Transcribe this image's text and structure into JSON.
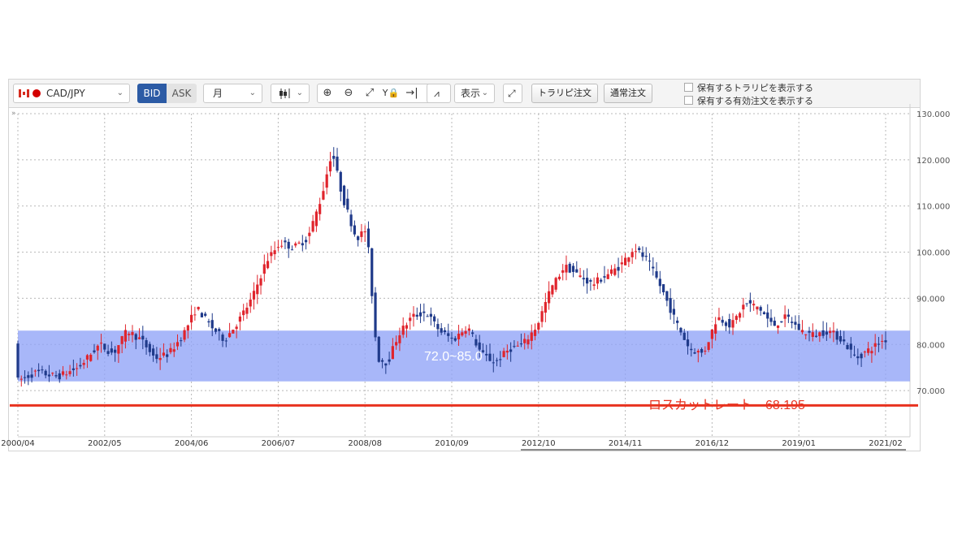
{
  "toolbar": {
    "pair": "CAD/JPY",
    "bid_label": "BID",
    "ask_label": "ASK",
    "timeframe": "月",
    "display_label": "表示",
    "trap_button": "トラリピ注文",
    "normal_button": "通常注文",
    "checkbox_positions": "保有するトラリピを表示する",
    "checkbox_orders": "保有する有効注文を表示する",
    "expand_mark": "»",
    "icons": [
      "candlestick-icon",
      "zoom-in-icon",
      "zoom-out-icon",
      "fit-icon",
      "y-lock-icon",
      "scroll-end-icon",
      "indicator-icon",
      "fullscreen-icon"
    ]
  },
  "annotations": {
    "band_label": "72.0~85.0",
    "losscut_label": "ロスカットレート　68.195"
  },
  "colors": {
    "up": "#e0242c",
    "down": "#1f3a8a",
    "band": "#8fa3f7",
    "losscut": "#e8321f",
    "accent": "#2c5ba5"
  },
  "chart_data": {
    "type": "candlestick",
    "title": "",
    "xlabel": "",
    "ylabel": "",
    "ylim": [
      60,
      130
    ],
    "y_ticks": [
      "130.000",
      "120.000",
      "110.000",
      "100.000",
      "90.000",
      "80.000",
      "70.000"
    ],
    "x_ticks": [
      "2000/04",
      "2002/05",
      "2004/06",
      "2006/07",
      "2008/08",
      "2010/09",
      "2012/10",
      "2014/11",
      "2016/12",
      "2019/01",
      "2021/02"
    ],
    "x_range": [
      "2000/04",
      "2021/02"
    ],
    "grid": true,
    "band": {
      "from": 72.0,
      "to": 83.0,
      "label": "72.0~85.0"
    },
    "losscut": {
      "value": 68.195,
      "label": "ロスカットレート　68.195"
    },
    "series": [
      {
        "t": "2000/04",
        "v": 72
      },
      {
        "t": "2000/10",
        "v": 74
      },
      {
        "t": "2001/04",
        "v": 73
      },
      {
        "t": "2001/10",
        "v": 75
      },
      {
        "t": "2002/04",
        "v": 80
      },
      {
        "t": "2002/08",
        "v": 78
      },
      {
        "t": "2002/12",
        "v": 83
      },
      {
        "t": "2003/04",
        "v": 81
      },
      {
        "t": "2003/08",
        "v": 77
      },
      {
        "t": "2003/12",
        "v": 78
      },
      {
        "t": "2004/04",
        "v": 82
      },
      {
        "t": "2004/08",
        "v": 88
      },
      {
        "t": "2004/12",
        "v": 84
      },
      {
        "t": "2005/04",
        "v": 81
      },
      {
        "t": "2005/08",
        "v": 85
      },
      {
        "t": "2005/12",
        "v": 90
      },
      {
        "t": "2006/04",
        "v": 98
      },
      {
        "t": "2006/08",
        "v": 102
      },
      {
        "t": "2006/12",
        "v": 101
      },
      {
        "t": "2007/04",
        "v": 103
      },
      {
        "t": "2007/08",
        "v": 112
      },
      {
        "t": "2007/11",
        "v": 122
      },
      {
        "t": "2008/02",
        "v": 112
      },
      {
        "t": "2008/06",
        "v": 103
      },
      {
        "t": "2008/09",
        "v": 105
      },
      {
        "t": "2008/12",
        "v": 77
      },
      {
        "t": "2009/03",
        "v": 76
      },
      {
        "t": "2009/06",
        "v": 82
      },
      {
        "t": "2009/10",
        "v": 86
      },
      {
        "t": "2010/02",
        "v": 87
      },
      {
        "t": "2010/06",
        "v": 83
      },
      {
        "t": "2010/10",
        "v": 81
      },
      {
        "t": "2011/02",
        "v": 84
      },
      {
        "t": "2011/06",
        "v": 78
      },
      {
        "t": "2011/10",
        "v": 76
      },
      {
        "t": "2012/02",
        "v": 79
      },
      {
        "t": "2012/06",
        "v": 80
      },
      {
        "t": "2012/10",
        "v": 84
      },
      {
        "t": "2013/02",
        "v": 92
      },
      {
        "t": "2013/06",
        "v": 97
      },
      {
        "t": "2013/10",
        "v": 95
      },
      {
        "t": "2014/02",
        "v": 93
      },
      {
        "t": "2014/06",
        "v": 95
      },
      {
        "t": "2014/10",
        "v": 97
      },
      {
        "t": "2015/02",
        "v": 101
      },
      {
        "t": "2015/06",
        "v": 98
      },
      {
        "t": "2015/10",
        "v": 92
      },
      {
        "t": "2016/02",
        "v": 85
      },
      {
        "t": "2016/06",
        "v": 79
      },
      {
        "t": "2016/10",
        "v": 78
      },
      {
        "t": "2017/02",
        "v": 86
      },
      {
        "t": "2017/06",
        "v": 84
      },
      {
        "t": "2017/10",
        "v": 89
      },
      {
        "t": "2018/02",
        "v": 88
      },
      {
        "t": "2018/06",
        "v": 84
      },
      {
        "t": "2018/10",
        "v": 86
      },
      {
        "t": "2019/02",
        "v": 83
      },
      {
        "t": "2019/06",
        "v": 82
      },
      {
        "t": "2019/10",
        "v": 83
      },
      {
        "t": "2020/02",
        "v": 81
      },
      {
        "t": "2020/06",
        "v": 77
      },
      {
        "t": "2020/10",
        "v": 79
      },
      {
        "t": "2021/02",
        "v": 81
      }
    ]
  }
}
